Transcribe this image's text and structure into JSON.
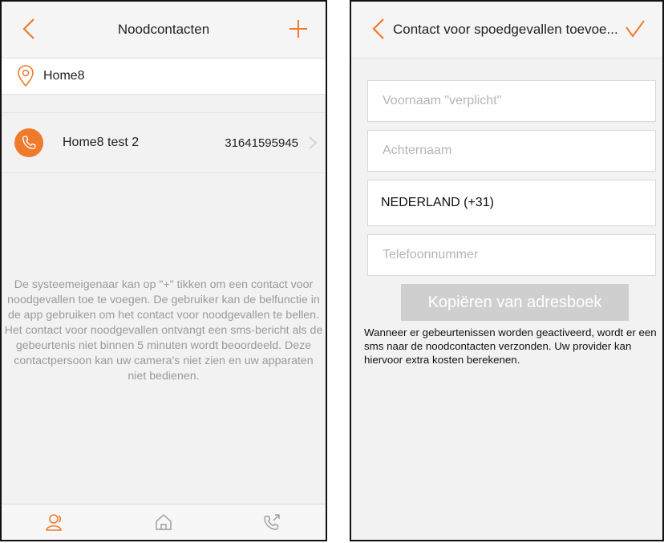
{
  "left": {
    "title": "Noodcontacten",
    "location": "Home8",
    "contact": {
      "name": "Home8 test 2",
      "phone": "31641595945"
    },
    "info": "De systeemeigenaar kan op \"+\" tikken om een contact voor noodgevallen toe te voegen. De gebruiker kan de belfunctie in de app gebruiken om het contact voor noodgevallen te bellen. Het contact voor noodgevallen ontvangt een sms-bericht als de gebeurtenis niet binnen 5 minuten wordt beoordeeld. Deze contactpersoon kan uw camera's niet zien en uw apparaten niet bedienen.",
    "tabs": [
      "contacts-icon",
      "home-icon",
      "call-icon"
    ]
  },
  "right": {
    "title": "Contact voor spoedgevallen toevoe...",
    "fields": {
      "firstname_placeholder": "Voornaam \"verplicht\"",
      "lastname_placeholder": "Achternaam",
      "country": "NEDERLAND (+31)",
      "phone_placeholder": "Telefoonnummer"
    },
    "copy_button": "Kopiëren van adresboek",
    "note": "Wanneer er gebeurtenissen worden geactiveerd, wordt er een sms naar de noodcontacten verzonden. Uw provider kan hiervoor extra kosten berekenen."
  },
  "colors": {
    "accent": "#f07a2b",
    "text": "#222222",
    "muted": "#9a9a9a",
    "button_disabled": "#cfcfcf"
  }
}
